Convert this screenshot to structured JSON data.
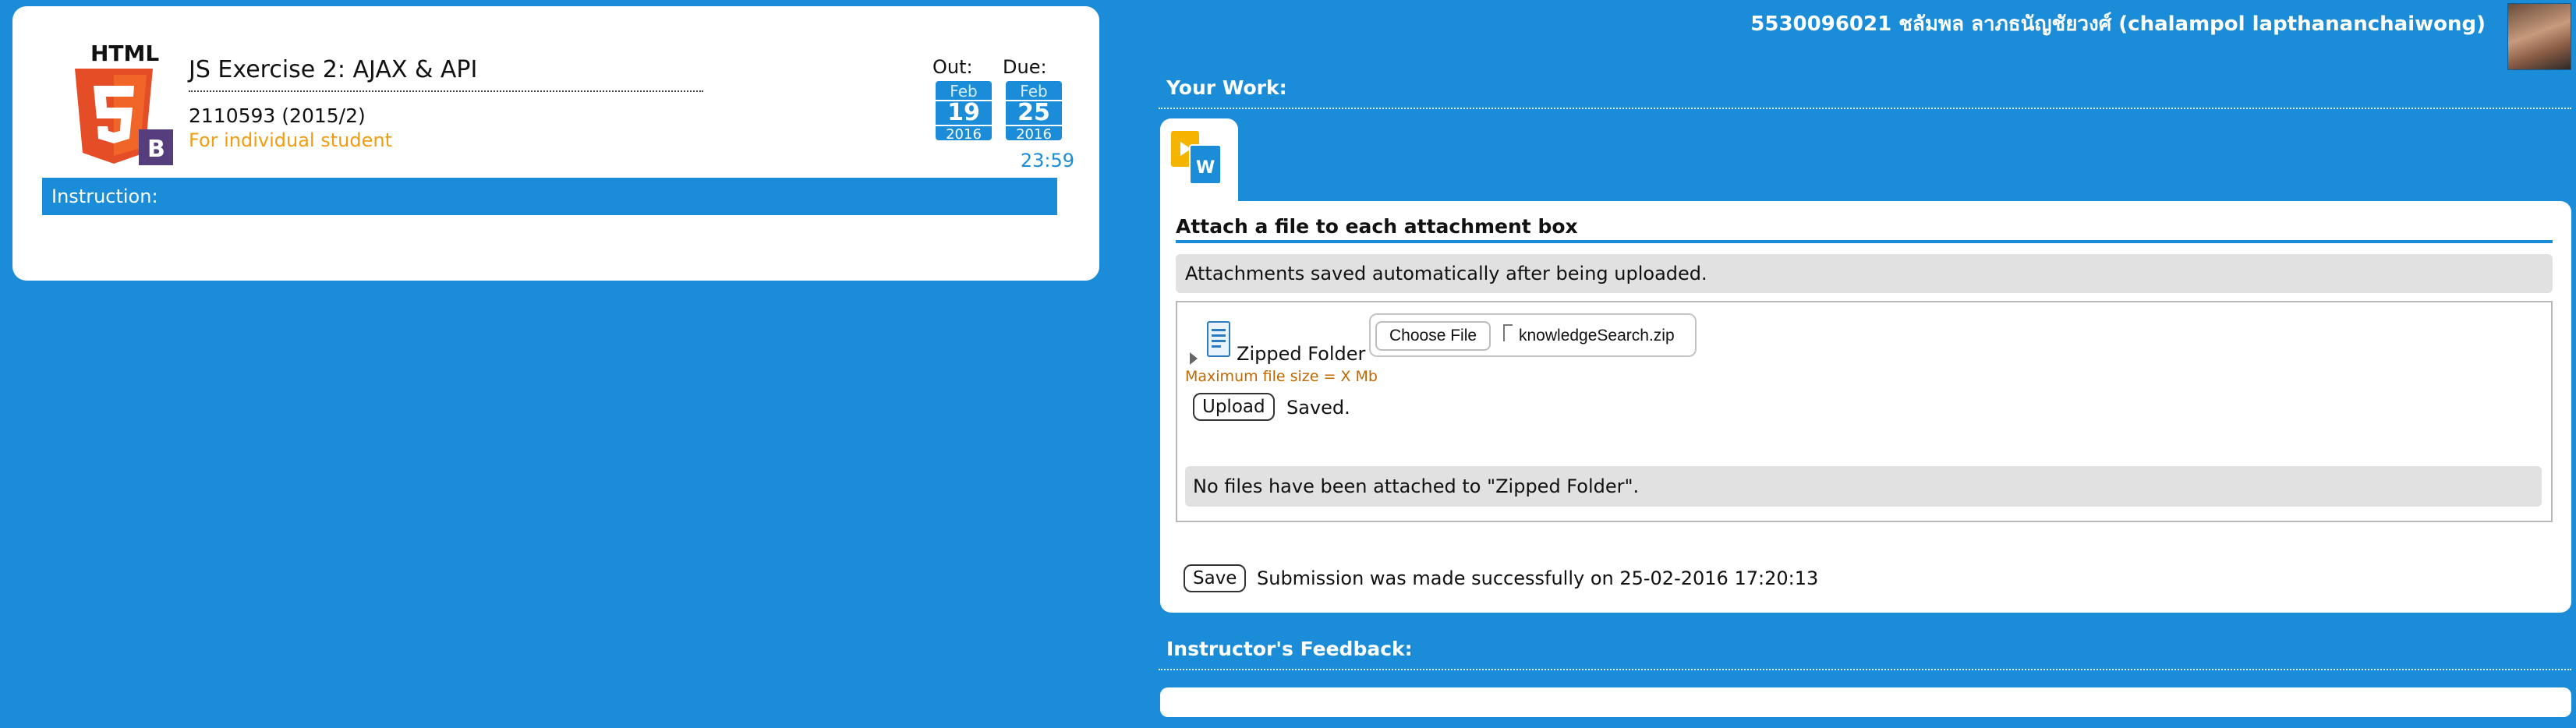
{
  "assignment": {
    "title": "JS Exercise 2: AJAX & API",
    "course": "2110593 (2015/2)",
    "audience": "For individual student",
    "logo": {
      "icon": "html5-bootstrap-logo",
      "text": "HTML",
      "badge_letter": "B"
    },
    "out": {
      "label": "Out:",
      "month": "Feb",
      "day": "19",
      "year": "2016"
    },
    "due": {
      "label": "Due:",
      "month": "Feb",
      "day": "25",
      "year": "2016",
      "time": "23:59"
    },
    "instruction_label": "Instruction:"
  },
  "user": {
    "name": "5530096021 ชลัมพล ลาภธนัญชัยวงศ์ (chalampol lapthananchaiwong)",
    "avatar": "user-avatar-photo"
  },
  "your_work": {
    "heading": "Your Work:",
    "tab_icon": "slides-word-files-icon",
    "attach_title": "Attach a file to each attachment box",
    "auto_save_note": "Attachments saved automatically after being uploaded.",
    "attachment": {
      "folder_label": "Zipped Folder",
      "choose_button": "Choose File",
      "file_name": "knowledgeSearch.zip",
      "max_size_note": "Maximum file size = X Mb",
      "upload_button": "Upload",
      "upload_status": "Saved.",
      "no_files_note": "No files have been attached to \"Zipped Folder\"."
    },
    "save_button": "Save",
    "submission_status": "Submission was made successfully on 25-02-2016 17:20:13"
  },
  "feedback": {
    "heading": "Instructor's Feedback:"
  },
  "colors": {
    "background": "#1b8dd8",
    "accent_orange": "#f39c12",
    "html5_orange": "#e44d26",
    "bootstrap_purple": "#563d7c"
  }
}
